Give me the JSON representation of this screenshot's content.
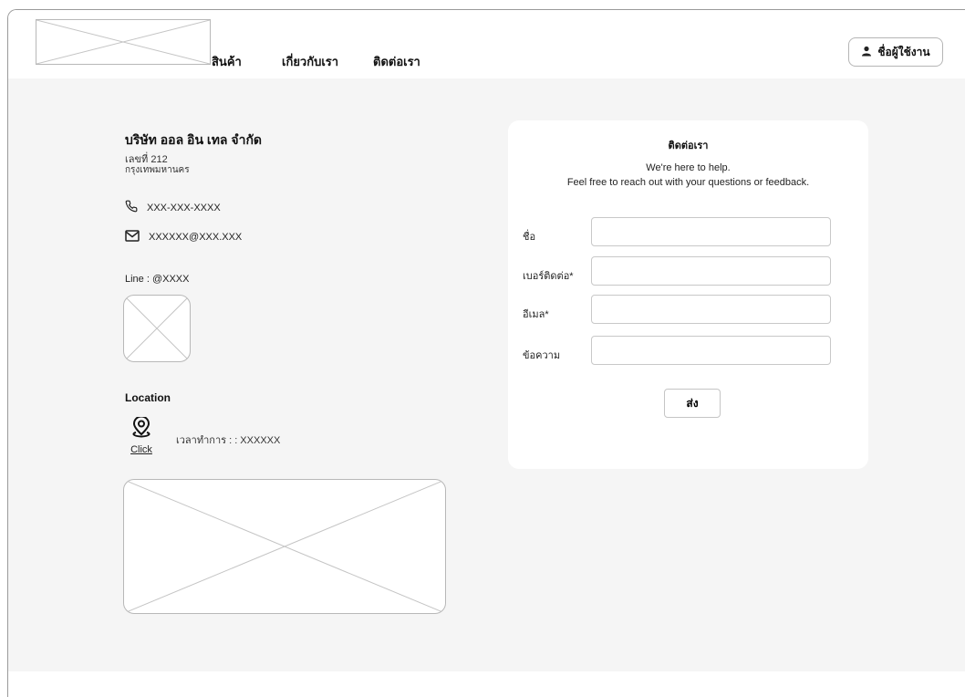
{
  "header": {
    "logo_icon": "image-placeholder-icon",
    "nav": [
      {
        "label": "สินค้า"
      },
      {
        "label": "เกี่ยวกับเรา"
      },
      {
        "label": "ติดต่อเรา"
      }
    ],
    "user_button": {
      "label": "ชื่อผู้ใช้งาน",
      "icon": "user-icon"
    }
  },
  "company": {
    "name": "บริษัท ออล อิน เทล จำกัด",
    "address_line1": "เลขที่ 212",
    "address_line2": "กรุงเทพมหานคร",
    "phone": "XXX-XXX-XXXX",
    "phone_icon": "phone-icon",
    "email": "XXXXXX@XXX.XXX",
    "email_icon": "mail-icon",
    "line": "Line : @XXXX",
    "qr_icon": "image-placeholder-icon"
  },
  "location": {
    "title": "Location",
    "pin_icon": "location-pin-icon",
    "click_label": "Click",
    "hours": "เวลาทำการ : : XXXXXX",
    "map_icon": "image-placeholder-icon"
  },
  "contact_form": {
    "title": "ติดต่อเรา",
    "subtitle_line1": "We're here to help.",
    "subtitle_line2": "Feel free to reach out with your questions or feedback.",
    "fields": [
      {
        "label": "ชื่อ",
        "value": ""
      },
      {
        "label": "เบอร์ติดต่อ*",
        "value": ""
      },
      {
        "label": "อีเมล*",
        "value": ""
      },
      {
        "label": "ข้อความ",
        "value": ""
      }
    ],
    "submit_label": "ส่ง"
  },
  "colors": {
    "page_background": "#f5f5f5",
    "card_background": "#ffffff",
    "border": "#c8c8c8",
    "text": "#111111"
  }
}
